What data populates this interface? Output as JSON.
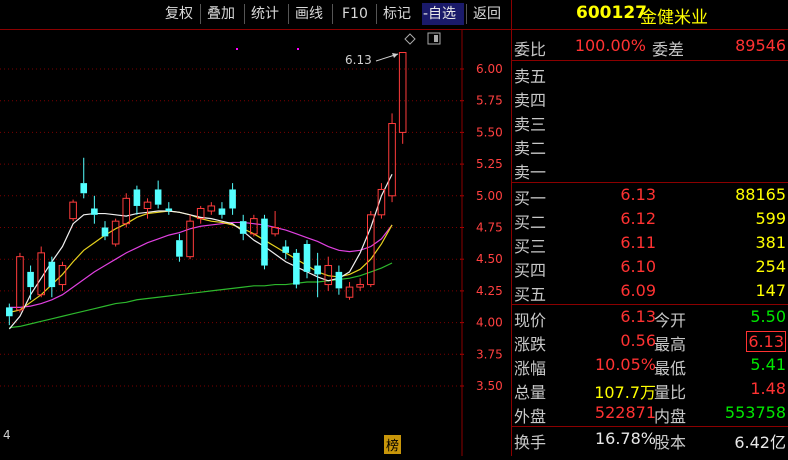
{
  "toolbar": {
    "buttons": [
      "复权",
      "叠加",
      "统计",
      "画线",
      "F10",
      "标记",
      "-自选",
      "返回"
    ]
  },
  "quote": {
    "code": "600127",
    "name": "金健米业",
    "weibi_label": "委比",
    "weibi": "100.00%",
    "weicha_label": "委差",
    "weicha": "89546",
    "sell": [
      {
        "label": "卖五"
      },
      {
        "label": "卖四"
      },
      {
        "label": "卖三"
      },
      {
        "label": "卖二"
      },
      {
        "label": "卖一"
      }
    ],
    "buy": [
      {
        "label": "买一",
        "price": "6.13",
        "vol": "88165"
      },
      {
        "label": "买二",
        "price": "6.12",
        "vol": "599"
      },
      {
        "label": "买三",
        "price": "6.11",
        "vol": "381"
      },
      {
        "label": "买四",
        "price": "6.10",
        "vol": "254"
      },
      {
        "label": "买五",
        "price": "6.09",
        "vol": "147"
      }
    ],
    "stats": [
      {
        "l1": "现价",
        "v1": "6.13",
        "c1": "red",
        "l2": "今开",
        "v2": "5.50",
        "c2": "green"
      },
      {
        "l1": "涨跌",
        "v1": "0.56",
        "c1": "red",
        "l2": "最高",
        "v2": "6.13",
        "c2": "red-boxed"
      },
      {
        "l1": "涨幅",
        "v1": "10.05%",
        "c1": "red",
        "l2": "最低",
        "v2": "5.41",
        "c2": "green"
      },
      {
        "l1": "总量",
        "v1": "107.7万",
        "c1": "yellow",
        "l2": "量比",
        "v2": "1.48",
        "c2": "red"
      },
      {
        "l1": "外盘",
        "v1": "522871",
        "c1": "red",
        "l2": "内盘",
        "v2": "553758",
        "c2": "green"
      },
      {
        "l1": "换手",
        "v1": "16.78%",
        "c1": "white",
        "l2": "股本",
        "v2": "6.42亿",
        "c2": "white"
      }
    ]
  },
  "chart": {
    "high_label": "6.13",
    "left_label": "4",
    "badge": "榜",
    "y_ticks": [
      "6.00",
      "5.75",
      "5.50",
      "5.25",
      "5.00",
      "4.75",
      "4.50",
      "4.25",
      "4.00",
      "3.75",
      "3.50"
    ]
  },
  "chart_data": {
    "type": "candlestick",
    "ylim": [
      3.35,
      6.25
    ],
    "y_ticks": [
      6.0,
      5.75,
      5.5,
      5.25,
      5.0,
      4.75,
      4.5,
      4.25,
      4.0,
      3.75,
      3.5
    ],
    "candles": [
      {
        "o": 4.12,
        "c": 4.05,
        "h": 4.15,
        "l": 3.98
      },
      {
        "o": 4.1,
        "c": 4.52,
        "h": 4.55,
        "l": 4.08
      },
      {
        "o": 4.4,
        "c": 4.28,
        "h": 4.45,
        "l": 4.18
      },
      {
        "o": 4.22,
        "c": 4.55,
        "h": 4.6,
        "l": 4.2
      },
      {
        "o": 4.48,
        "c": 4.28,
        "h": 4.52,
        "l": 4.2
      },
      {
        "o": 4.3,
        "c": 4.45,
        "h": 4.48,
        "l": 4.25
      },
      {
        "o": 4.82,
        "c": 4.95,
        "h": 4.97,
        "l": 4.8
      },
      {
        "o": 5.1,
        "c": 5.02,
        "h": 5.3,
        "l": 4.98
      },
      {
        "o": 4.9,
        "c": 4.85,
        "h": 5.0,
        "l": 4.78
      },
      {
        "o": 4.75,
        "c": 4.68,
        "h": 4.8,
        "l": 4.65
      },
      {
        "o": 4.62,
        "c": 4.8,
        "h": 4.82,
        "l": 4.6
      },
      {
        "o": 4.78,
        "c": 4.98,
        "h": 5.02,
        "l": 4.75
      },
      {
        "o": 5.05,
        "c": 4.92,
        "h": 5.08,
        "l": 4.85
      },
      {
        "o": 4.9,
        "c": 4.95,
        "h": 4.98,
        "l": 4.82
      },
      {
        "o": 5.05,
        "c": 4.93,
        "h": 5.12,
        "l": 4.9
      },
      {
        "o": 4.9,
        "c": 4.88,
        "h": 4.95,
        "l": 4.85
      },
      {
        "o": 4.65,
        "c": 4.52,
        "h": 4.7,
        "l": 4.48
      },
      {
        "o": 4.52,
        "c": 4.8,
        "h": 4.85,
        "l": 4.5
      },
      {
        "o": 4.82,
        "c": 4.9,
        "h": 4.92,
        "l": 4.78
      },
      {
        "o": 4.88,
        "c": 4.92,
        "h": 4.95,
        "l": 4.85
      },
      {
        "o": 4.9,
        "c": 4.85,
        "h": 4.95,
        "l": 4.82
      },
      {
        "o": 5.05,
        "c": 4.9,
        "h": 5.1,
        "l": 4.85
      },
      {
        "o": 4.8,
        "c": 4.7,
        "h": 4.85,
        "l": 4.65
      },
      {
        "o": 4.7,
        "c": 4.82,
        "h": 4.85,
        "l": 4.68
      },
      {
        "o": 4.82,
        "c": 4.45,
        "h": 4.85,
        "l": 4.42
      },
      {
        "o": 4.7,
        "c": 4.75,
        "h": 4.88,
        "l": 4.68
      },
      {
        "o": 4.6,
        "c": 4.55,
        "h": 4.65,
        "l": 4.5
      },
      {
        "o": 4.55,
        "c": 4.3,
        "h": 4.58,
        "l": 4.27
      },
      {
        "o": 4.62,
        "c": 4.4,
        "h": 4.65,
        "l": 4.35
      },
      {
        "o": 4.45,
        "c": 4.38,
        "h": 4.55,
        "l": 4.2
      },
      {
        "o": 4.3,
        "c": 4.45,
        "h": 4.52,
        "l": 4.25
      },
      {
        "o": 4.4,
        "c": 4.27,
        "h": 4.45,
        "l": 4.22
      },
      {
        "o": 4.2,
        "c": 4.28,
        "h": 4.32,
        "l": 4.18
      },
      {
        "o": 4.28,
        "c": 4.3,
        "h": 4.35,
        "l": 4.25
      },
      {
        "o": 4.3,
        "c": 4.85,
        "h": 4.88,
        "l": 4.28
      },
      {
        "o": 4.85,
        "c": 5.05,
        "h": 5.1,
        "l": 4.82
      },
      {
        "o": 5.0,
        "c": 5.57,
        "h": 5.65,
        "l": 4.95
      },
      {
        "o": 5.5,
        "c": 6.13,
        "h": 6.13,
        "l": 5.41
      }
    ],
    "ma_white": [
      3.95,
      4.05,
      4.22,
      4.35,
      4.48,
      4.6,
      4.78,
      4.85,
      4.86,
      4.86,
      4.85,
      4.84,
      4.86,
      4.87,
      4.88,
      4.88,
      4.87,
      4.85,
      4.83,
      4.82,
      4.8,
      4.78,
      4.72,
      4.65,
      4.6,
      4.54,
      4.48,
      4.44,
      4.4,
      4.36,
      4.33,
      4.35,
      4.4,
      4.55,
      4.75,
      5.0,
      5.17
    ],
    "ma_yellow": [
      4.08,
      4.1,
      4.16,
      4.22,
      4.3,
      4.38,
      4.48,
      4.57,
      4.63,
      4.69,
      4.74,
      4.78,
      4.83,
      4.86,
      4.87,
      4.88,
      4.87,
      4.85,
      4.82,
      4.8,
      4.79,
      4.77,
      4.74,
      4.7,
      4.65,
      4.6,
      4.55,
      4.5,
      4.45,
      4.4,
      4.37,
      4.36,
      4.38,
      4.42,
      4.5,
      4.62,
      4.77
    ],
    "ma_magenta": [
      4.12,
      4.12,
      4.13,
      4.15,
      4.18,
      4.22,
      4.28,
      4.34,
      4.4,
      4.45,
      4.5,
      4.55,
      4.59,
      4.63,
      4.66,
      4.69,
      4.71,
      4.74,
      4.76,
      4.77,
      4.78,
      4.79,
      4.79,
      4.78,
      4.77,
      4.75,
      4.73,
      4.7,
      4.67,
      4.64,
      4.6,
      4.57,
      4.56,
      4.57,
      4.6,
      4.66,
      4.77
    ],
    "ma_green": [
      3.96,
      3.97,
      3.99,
      4.01,
      4.03,
      4.05,
      4.07,
      4.09,
      4.11,
      4.13,
      4.15,
      4.16,
      4.18,
      4.19,
      4.2,
      4.21,
      4.22,
      4.23,
      4.24,
      4.25,
      4.26,
      4.27,
      4.28,
      4.29,
      4.29,
      4.3,
      4.3,
      4.31,
      4.32,
      4.32,
      4.33,
      4.34,
      4.35,
      4.37,
      4.4,
      4.43,
      4.47
    ]
  }
}
